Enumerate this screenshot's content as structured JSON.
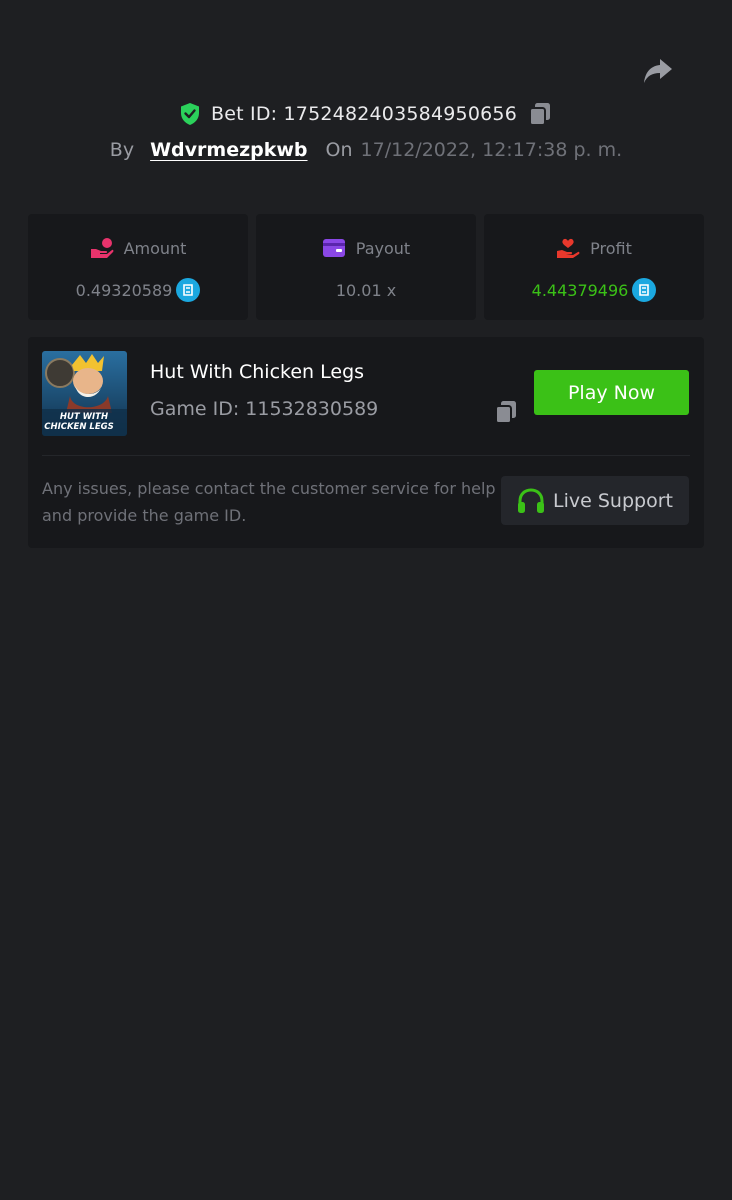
{
  "header": {
    "bet_id": "Bet ID: 1752482403584950656",
    "by_label": "By",
    "username": "Wdvrmezpkwb",
    "on_label": "On",
    "date": "17/12/2022, 12:17:38 p. m."
  },
  "stats": {
    "amount": {
      "label": "Amount",
      "value": "0.49320589",
      "icon": "hand-coin-icon",
      "color": "#e8336c"
    },
    "payout": {
      "label": "Payout",
      "value": "10.01 x",
      "icon": "wallet-card-icon",
      "color": "#8a47e6"
    },
    "profit": {
      "label": "Profit",
      "value": "4.44379496",
      "icon": "hand-heart-icon",
      "color": "#e8382c",
      "value_color": "#3bc117"
    }
  },
  "coin_icon": "bcd-coin-icon",
  "game": {
    "thumbnail_text": "HUT WITH CHICKEN LEGS",
    "name": "Hut With Chicken Legs",
    "game_id": "Game ID: 11532830589",
    "play_label": "Play Now",
    "issues_text": "Any issues, please contact the customer service for help and provide the game ID.",
    "support_label": "Live Support"
  },
  "colors": {
    "background": "#1e1f22",
    "card": "#17181b",
    "accent_green": "#3bc117",
    "verified": "#2bd15b"
  }
}
